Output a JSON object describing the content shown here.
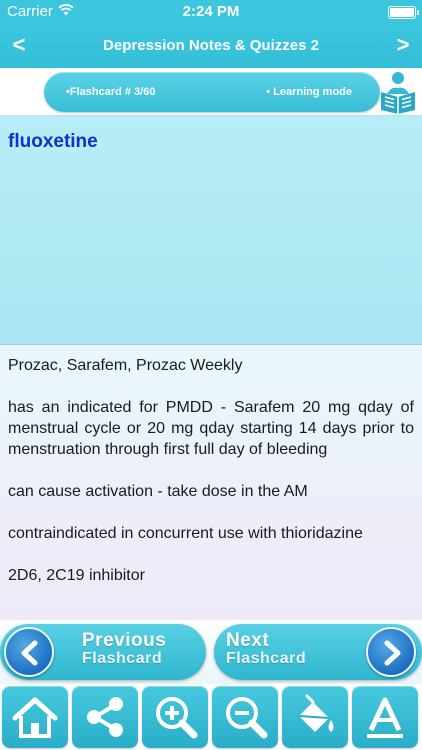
{
  "status_bar": {
    "carrier": "Carrier",
    "time": "2:24 PM"
  },
  "header": {
    "title": "Depression Notes & Quizzes 2",
    "back_arrow": "<",
    "forward_arrow": ">"
  },
  "flashcard_bar": {
    "counter": "•Flashcard #  3/60",
    "mode": "• Learning mode",
    "icon": "reader-icon"
  },
  "card": {
    "term": "fluoxetine",
    "details": [
      "Prozac, Sarafem, Prozac Weekly",
      "has an indicated for PMDD - Sarafem 20 mg qday of menstrual cycle or 20 mg qday starting 14 days prior to menstruation through first full day of bleeding",
      "can cause activation - take dose in the AM",
      "contraindicated in concurrent use with thioridazine",
      "2D6, 2C19 inhibitor"
    ]
  },
  "navigation": {
    "previous": {
      "line1": "Previous",
      "line2": "Flashcard"
    },
    "next": {
      "line1": "Next",
      "line2": "Flashcard"
    }
  },
  "toolbar": {
    "items": [
      {
        "icon": "home-icon"
      },
      {
        "icon": "share-icon"
      },
      {
        "icon": "zoom-in-icon"
      },
      {
        "icon": "zoom-out-icon"
      },
      {
        "icon": "paint-bucket-icon"
      },
      {
        "icon": "font-icon"
      }
    ]
  },
  "colors": {
    "accent": "#3cc6de",
    "term_color": "#1330c6",
    "nav_circle": "#1d6fc2"
  }
}
